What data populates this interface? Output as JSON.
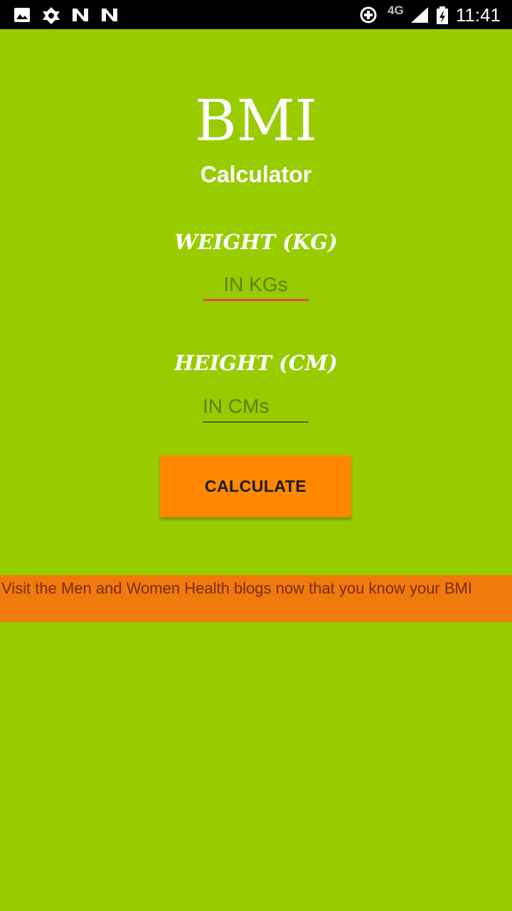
{
  "status_bar": {
    "time": "11:41",
    "network": "4G",
    "icons": [
      "image-icon",
      "vpn-icon",
      "n-notification-icon",
      "n-notification-icon",
      "data-saver-icon",
      "signal-icon",
      "battery-icon"
    ]
  },
  "app": {
    "title": "BMI",
    "subtitle": "Calculator",
    "background": "#99cc00"
  },
  "form": {
    "weight_label": "WEIGHT (KG)",
    "weight_placeholder": "IN KGs",
    "weight_value": "",
    "height_label": "HEIGHT (CM)",
    "height_placeholder": "IN CMs",
    "height_value": "",
    "button_label": "CALCULATE",
    "button_color": "#ff8800"
  },
  "banner": {
    "text": "Visit the Men and Women Health blogs now that you know your BMI",
    "color": "#f07a0c"
  }
}
